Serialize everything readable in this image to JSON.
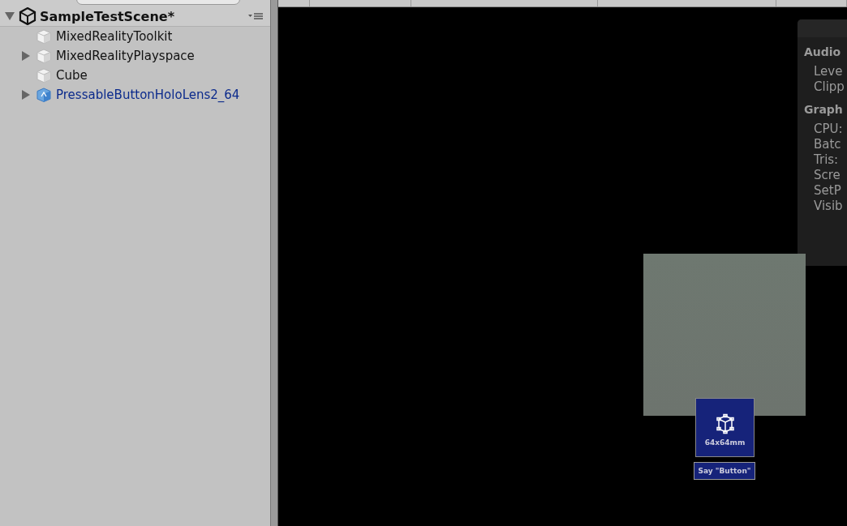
{
  "hierarchy": {
    "scene": {
      "title": "SampleTestScene*",
      "expanded": true
    },
    "items": [
      {
        "label": "MixedRealityToolkit",
        "kind": "object",
        "has_children": false
      },
      {
        "label": "MixedRealityPlayspace",
        "kind": "object",
        "has_children": true
      },
      {
        "label": "Cube",
        "kind": "object",
        "has_children": false
      },
      {
        "label": "PressableButtonHoloLens2_64",
        "kind": "prefab",
        "has_children": true
      }
    ]
  },
  "stats": {
    "sections": [
      {
        "title": "Audio",
        "lines": [
          "Leve",
          "Clipp"
        ]
      },
      {
        "title": "Graph",
        "lines": [
          "CPU:",
          "Batc",
          "Tris:",
          "Scre",
          "SetP",
          "Visib"
        ]
      }
    ]
  },
  "scene_view": {
    "button": {
      "caption": "64x64mm",
      "label": "Say \"Button\""
    }
  }
}
